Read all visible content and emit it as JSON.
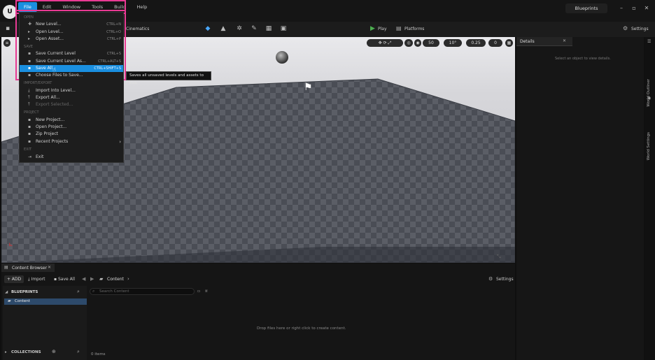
{
  "menubar": {
    "items": [
      "File",
      "Edit",
      "Window",
      "Tools",
      "Build",
      "Help"
    ]
  },
  "project_tab": "Blueprints",
  "toolbar": {
    "cinematics": "Cinematics",
    "play": "Play",
    "platforms": "Platforms",
    "settings": "Settings"
  },
  "viewport_controls": {
    "grid": "50",
    "angle": "10°",
    "scale": "0.25",
    "camera": "0"
  },
  "file_menu": {
    "sections": {
      "open": "OPEN",
      "save": "SAVE",
      "import_export": "IMPORT/EXPORT",
      "project": "PROJECT",
      "exit": "EXIT"
    },
    "items": [
      {
        "label": "New Level...",
        "shortcut": "CTRL+N"
      },
      {
        "label": "Open Level...",
        "shortcut": "CTRL+O"
      },
      {
        "label": "Open Asset...",
        "shortcut": "CTRL+P"
      },
      {
        "label": "Save Current Level",
        "shortcut": "CTRL+S"
      },
      {
        "label": "Save Current Level As...",
        "shortcut": "CTRL+ALT+S"
      },
      {
        "label": "Save All",
        "shortcut": "CTRL+SHIFT+S"
      },
      {
        "label": "Choose Files to Save...",
        "shortcut": ""
      },
      {
        "label": "Import Into Level...",
        "shortcut": ""
      },
      {
        "label": "Export All...",
        "shortcut": ""
      },
      {
        "label": "Export Selected...",
        "shortcut": ""
      },
      {
        "label": "New Project...",
        "shortcut": ""
      },
      {
        "label": "Open Project...",
        "shortcut": ""
      },
      {
        "label": "Zip Project",
        "shortcut": ""
      },
      {
        "label": "Recent Projects",
        "shortcut": ""
      },
      {
        "label": "Exit",
        "shortcut": ""
      }
    ]
  },
  "tooltip": "Saves all unsaved levels and assets to disk",
  "details": {
    "tab": "Details",
    "empty_msg": "Select an object to view details."
  },
  "right_tabs": {
    "outliner": "World Outliner",
    "settings": "World Settings"
  },
  "content_browser": {
    "tab": "Content Browser",
    "add": "ADD",
    "import": "Import",
    "save_all": "Save All",
    "path": "Content",
    "settings": "Settings",
    "blueprints": "BLUEPRINTS",
    "folder": "Content",
    "search_placeholder": "Search Content",
    "empty_msg": "Drop files here or right click to create content.",
    "collections": "COLLECTIONS",
    "count": "0 items"
  }
}
